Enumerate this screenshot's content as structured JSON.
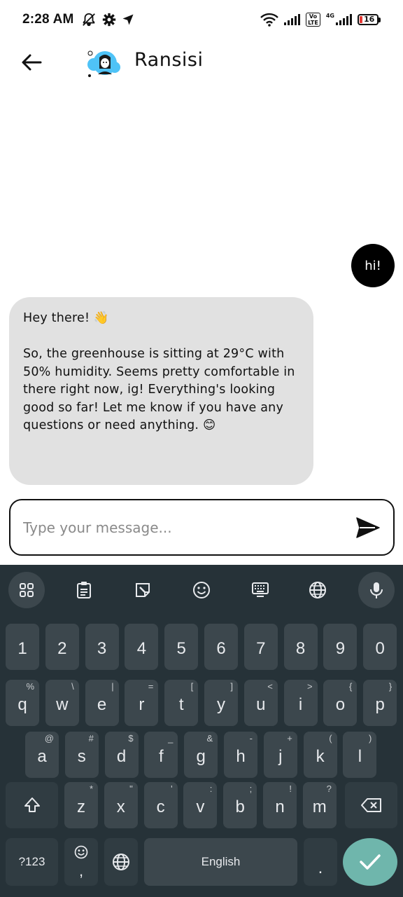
{
  "status_bar": {
    "time": "2:28 AM",
    "lte_label": "Vo\nLTE",
    "net_label": "4G",
    "battery": "16"
  },
  "header": {
    "title": "Ransisi"
  },
  "chat": {
    "messages": [
      {
        "from": "user",
        "text": "hi!"
      },
      {
        "from": "bot",
        "text": "Hey there! 👋\n\nSo, the greenhouse is sitting at 29°C with 50% humidity.  Seems pretty comfortable in there right now, ig! Everything's looking good so far!  Let me know if you have any questions or need anything. 😊"
      }
    ]
  },
  "composer": {
    "placeholder": "Type your message...",
    "value": ""
  },
  "keyboard": {
    "number_row": [
      "1",
      "2",
      "3",
      "4",
      "5",
      "6",
      "7",
      "8",
      "9",
      "0"
    ],
    "row1": [
      {
        "k": "q",
        "s": "%"
      },
      {
        "k": "w",
        "s": "\\"
      },
      {
        "k": "e",
        "s": "|"
      },
      {
        "k": "r",
        "s": "="
      },
      {
        "k": "t",
        "s": "["
      },
      {
        "k": "y",
        "s": "]"
      },
      {
        "k": "u",
        "s": "<"
      },
      {
        "k": "i",
        "s": ">"
      },
      {
        "k": "o",
        "s": "{"
      },
      {
        "k": "p",
        "s": "}"
      }
    ],
    "row2": [
      {
        "k": "a",
        "s": "@"
      },
      {
        "k": "s",
        "s": "#"
      },
      {
        "k": "d",
        "s": "$"
      },
      {
        "k": "f",
        "s": "_"
      },
      {
        "k": "g",
        "s": "&"
      },
      {
        "k": "h",
        "s": "-"
      },
      {
        "k": "j",
        "s": "+"
      },
      {
        "k": "k",
        "s": "("
      },
      {
        "k": "l",
        "s": ")"
      }
    ],
    "row3": [
      {
        "k": "z",
        "s": "*"
      },
      {
        "k": "x",
        "s": "\""
      },
      {
        "k": "c",
        "s": "'"
      },
      {
        "k": "v",
        "s": ":"
      },
      {
        "k": "b",
        "s": ";"
      },
      {
        "k": "n",
        "s": "!"
      },
      {
        "k": "m",
        "s": "?"
      }
    ],
    "symbols_label": "?123",
    "comma_label": ",",
    "space_label": "English",
    "period_label": "."
  }
}
